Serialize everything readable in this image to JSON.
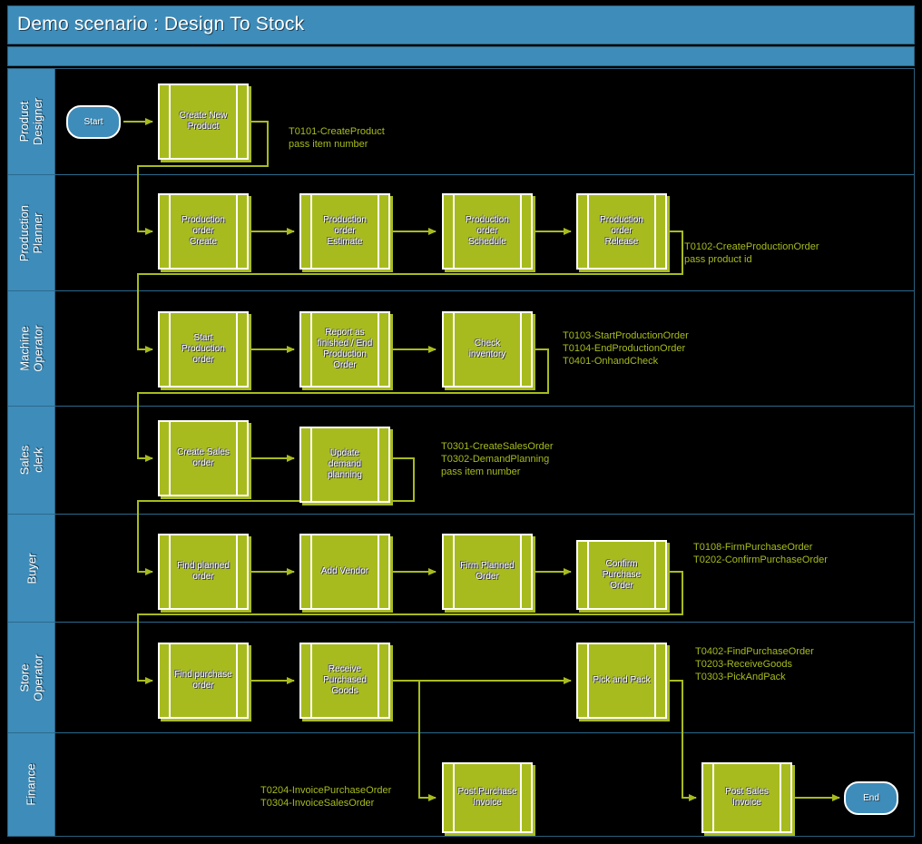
{
  "header": {
    "title": "Demo scenario : Design To Stock"
  },
  "lanes": [
    {
      "id": "product-designer",
      "label": "Product\nDesigner"
    },
    {
      "id": "production-planner",
      "label": "Production\nPlanner"
    },
    {
      "id": "machine-operator",
      "label": "Machine\nOperator"
    },
    {
      "id": "sales-clerk",
      "label": "Sales clerk"
    },
    {
      "id": "buyer",
      "label": "Buyer"
    },
    {
      "id": "store-operator",
      "label": "Store Operator"
    },
    {
      "id": "finance",
      "label": "Finance"
    }
  ],
  "events": {
    "start": "Start",
    "end": "End"
  },
  "tasks": {
    "create_new_product": "Create New\nProduct",
    "production_order_create": "Production\norder\nCreate",
    "production_order_estimate": "Production\norder\nEstimate",
    "production_order_schedule": "Production\norder\nSchedule",
    "production_order_release": "Production\norder\nRelease",
    "start_production_order": "Start\nProduction\norder",
    "report_as_finished": "Report as\nfinished / End\nProduction\nOrder",
    "check_inventory": "Check\ninventory",
    "create_sales_order": "Create Sales\norder",
    "update_demand_planning": "Update\ndemand\nplanning",
    "find_planned_order": "Find planned\norder",
    "add_vendor": "Add Vendor",
    "firm_planned_order": "Firm Planned\nOrder",
    "confirm_purchase_order": "Confirm\nPurchase\nOrder",
    "find_purchase_order": "Find purchase\norder",
    "receive_purchased_goods": "Receive\nPurchased\nGoods",
    "pick_and_pack": "Pick and Pack",
    "post_purchase_invoice": "Post Purchase\nInvoice",
    "post_sales_invoice": "Post Sales\nInvoice"
  },
  "annotations": {
    "product_designer": "T0101-CreateProduct\npass item number",
    "production_planner": "T0102-CreateProductionOrder\npass product id",
    "machine_operator": "T0103-StartProductionOrder\nT0104-EndProductionOrder\nT0401-OnhandCheck",
    "sales_clerk": "T0301-CreateSalesOrder\nT0302-DemandPlanning\npass item number",
    "buyer": "T0108-FirmPurchaseOrder\nT0202-ConfirmPurchaseOrder",
    "store_operator": "T0402-FindPurchaseOrder\nT0203-ReceiveGoods\nT0303-PickAndPack",
    "finance": "T0204-InvoicePurchaseOrder\nT0304-InvoiceSalesOrder"
  },
  "colors": {
    "lane_blue": "#3e8cb9",
    "task_green": "#a8bb1e",
    "canvas_black": "#000000",
    "lane_divider": "#2b6a8e",
    "connector": "#a8bb1e",
    "text_white": "#ffffff"
  }
}
